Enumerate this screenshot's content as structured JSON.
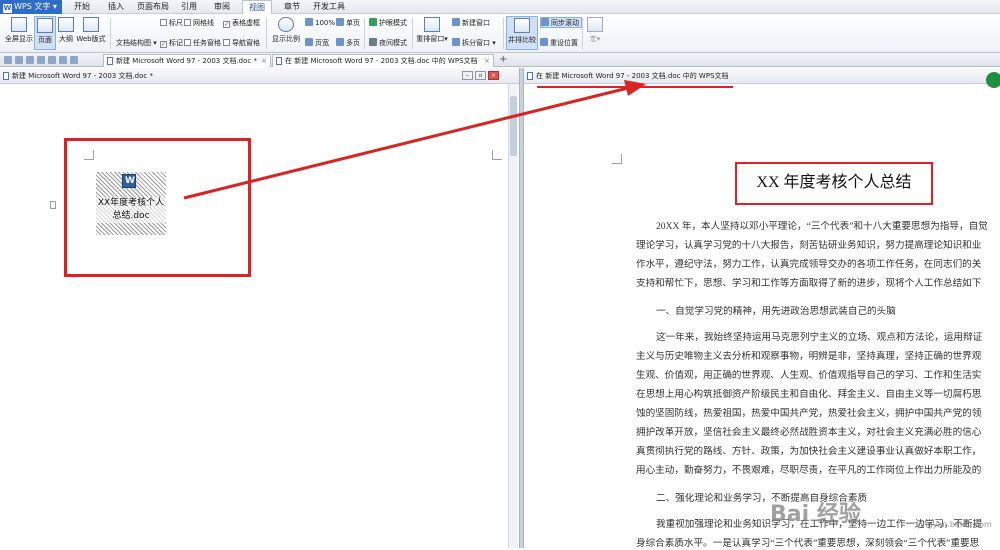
{
  "app": {
    "name": "WPS 文字"
  },
  "menu": [
    "开始",
    "插入",
    "页面布局",
    "引用",
    "审阅",
    "视图",
    "章节",
    "开发工具"
  ],
  "active_menu": "视图",
  "ribbon": {
    "full_screen": "全屏显示",
    "page": "页面",
    "outline": "大纲",
    "web_layout": "Web版式",
    "doc_structure": "文档结构图",
    "ruler": "标尺",
    "gridlines": "网格线",
    "table_gridlines": "表格虚框",
    "marks": "标记",
    "task_pane": "任务窗格",
    "nav_pane": "导航窗格",
    "zoom": "显示比例",
    "zoom_100": "100%",
    "page_width": "页宽",
    "one_page": "单页",
    "multi_page": "多页",
    "eye_mode": "护眼模式",
    "night_mode": "夜间模式",
    "rearrange": "重排窗口",
    "new_window": "新建窗口",
    "split_window": "拆分窗口",
    "side_by_side": "并排比较",
    "sync_scroll": "同步滚动",
    "reset_position": "重设位置",
    "macro": "宏"
  },
  "tabs": [
    {
      "label": "新建 Microsoft Word 97 - 2003 文档.doc *"
    },
    {
      "label": "在 新建 Microsoft Word 97 - 2003 文档.doc 中的 WPS文档"
    }
  ],
  "left_pane": {
    "title": "新建 Microsoft Word 97 - 2003 文档.doc *",
    "object_label": "XX年度考核个人总结.doc"
  },
  "right_pane": {
    "title": "在 新建 Microsoft Word 97 - 2003 文档.doc 中的 WPS文档",
    "doc_title": "XX 年度考核个人总结",
    "lines": [
      "20XX 年，本人坚持以邓小平理论，“三个代表”和十八大重要思想为指导，自觉",
      "理论学习，认真学习党的十八大报告，刻苦钻研业务知识，努力提高理论知识和业",
      "作水平，遵纪守法，努力工作，认真完成领导交办的各项工作任务，在同志们的关",
      "支持和帮忙下，思想、学习和工作等方面取得了新的进步，现将个人工作总结如下",
      "一、自觉学习党的精神，用先进政治思想武装自己的头脑",
      "这一年来，我始终坚持运用马克思列宁主义的立场、观点和方法论，运用辩证",
      "主义与历史唯物主义去分析和观察事物，明辨是非，坚持真理，坚持正确的世界观",
      "生观、价值观，用正确的世界观、人生观、价值观指导自己的学习、工作和生活实",
      "在思想上用心构筑抵御资产阶级民主和自由化、拜金主义、自由主义等一切腐朽思",
      "蚀的坚固防线，热爱祖国，热爱中国共产党，热爱社会主义，拥护中国共产党的领",
      "拥护改革开放，坚信社会主义最终必然战胜资本主义，对社会主义充满必胜的信心",
      "真贯彻执行党的路线、方针、政策，为加快社会主义建设事业认真做好本职工作，",
      "用心主动，勤奋努力，不畏艰难，尽职尽责，在平凡的工作岗位上作出力所能及的",
      "二、强化理论和业务学习，不断提高自身综合素质",
      "我重视加强理论和业务知识学习，在工作中，坚持一边工作一边学习，不断提",
      "身综合素质水平。一是认真学习“三个代表”重要思想，深刻领会“三个代表”重要思"
    ]
  },
  "watermark": {
    "text": "Bai 经验",
    "sub": "jingyan.baidu.com"
  },
  "colors": {
    "annotation_red": "#d92424",
    "ribbon_blue": "#2f6bc9"
  }
}
